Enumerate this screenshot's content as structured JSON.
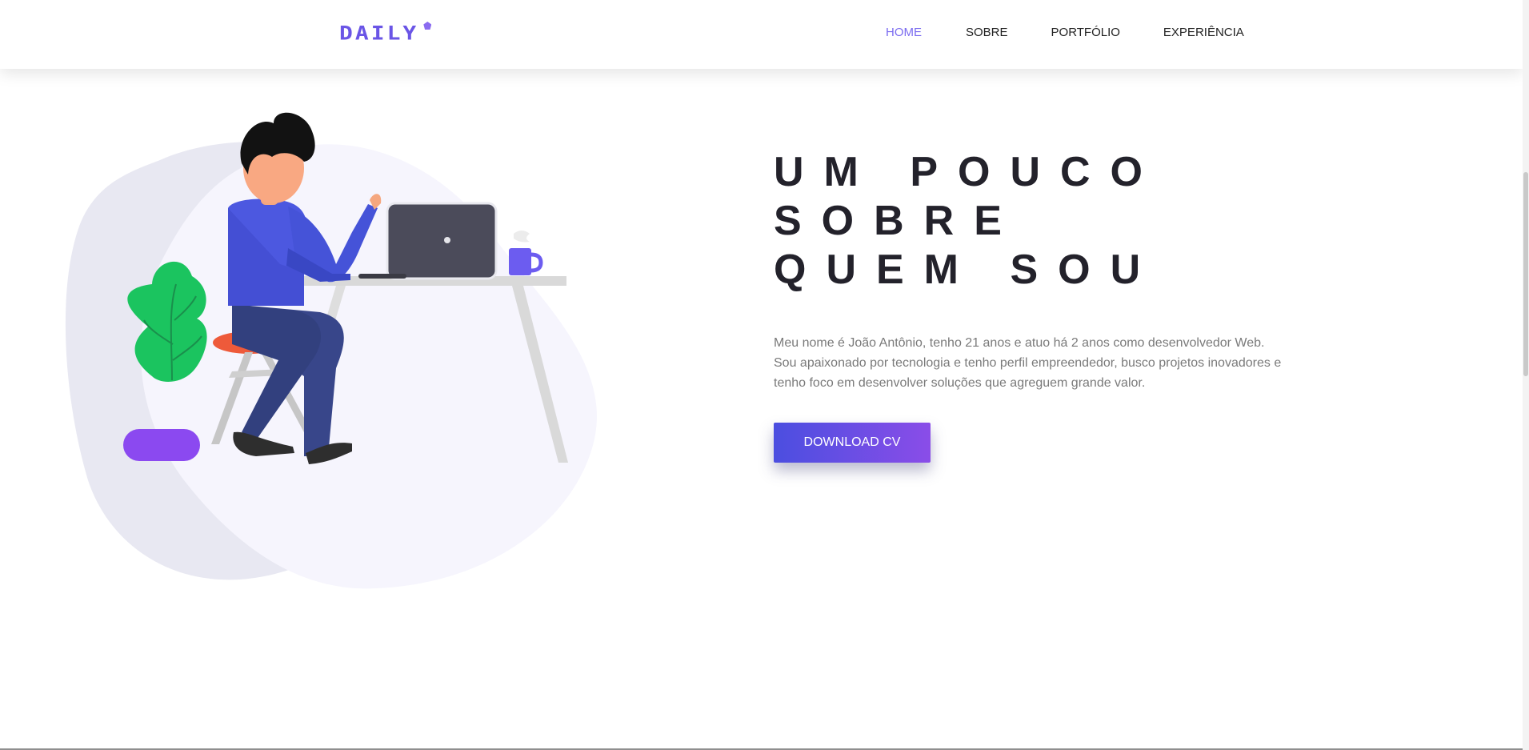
{
  "header": {
    "logo_text": "DAILY",
    "nav": {
      "home": "HOME",
      "sobre": "SOBRE",
      "portfolio": "PORTFÓLIO",
      "experiencia": "EXPERIÊNCIA"
    }
  },
  "about": {
    "title_lines": [
      "UM POUCO",
      "SOBRE",
      "QUEM SOU"
    ],
    "description": "Meu nome é João Antônio, tenho 21 anos e atuo há 2 anos como desenvolvedor Web. Sou apaixonado por tecnologia e tenho perfil empreendedor, busco projetos inovadores e tenho foco em desenvolver soluções que agreguem grande valor.",
    "download_label": "DOWNLOAD CV"
  },
  "colors": {
    "accent": "#7b6cf0",
    "button_gradient_start": "#4b4ee0",
    "button_gradient_end": "#8a4de8",
    "title": "#23222b",
    "body_text": "#7a7a7a"
  }
}
